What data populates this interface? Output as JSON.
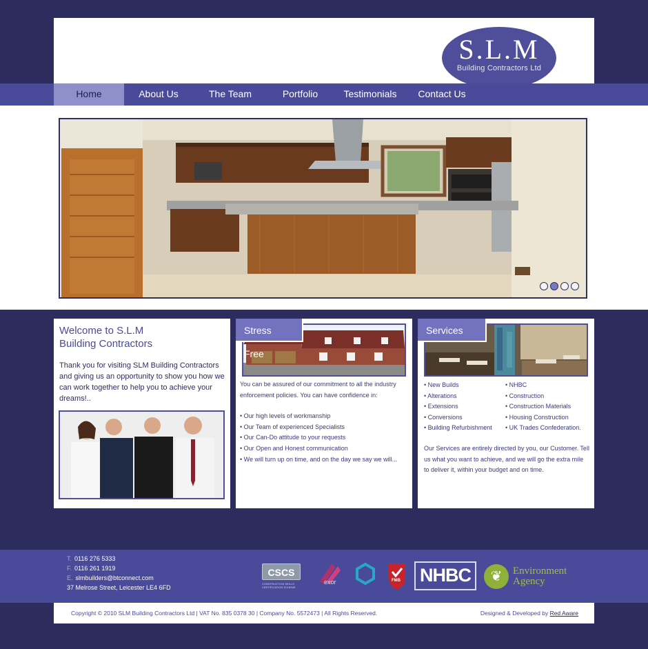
{
  "logo": {
    "title": "S.L.M",
    "subtitle": "Building Contractors Ltd"
  },
  "nav": [
    "Home",
    "About Us",
    "The Team",
    "Portfolio",
    "Testimonials",
    "Contact Us"
  ],
  "nav_active": "Home",
  "slider": {
    "slide_count": 4,
    "active_slide": 2
  },
  "welcome": {
    "title_line1": "Welcome to S.L.M",
    "title_line2": "Building Contractors",
    "text": "Thank you for visiting SLM Building Contractors and giving us an opportunity to show you how we can work together to help you to achieve your dreams!.."
  },
  "stress": {
    "label": "Stress Free",
    "intro": "You can be assured of our commitment to all the industry enforcement policies. You can have confidence in:",
    "items": [
      "• Our high levels of workmanship",
      "• Our Team of experienced Specialists",
      "• Our Can-Do attitude to your requests",
      "• Our Open and Honest communication",
      "• We will turn up on time, and on the day we say we will..."
    ]
  },
  "services": {
    "label": "Services",
    "col1": [
      "• New Builds",
      "• Alterations",
      "• Extensions",
      "• Conversions",
      "• Building Refurbishment"
    ],
    "col2": [
      "• NHBC",
      "• Construction",
      "• Construction Materials",
      "• Housing Construction",
      "• UK Trades Confederation."
    ],
    "text": "Our Services are entirely directed by you, our Customer. Tell us what you want to achieve, and we will go the extra mile to deliver it, within your budget and on time."
  },
  "contact": {
    "t_label": "T.",
    "t": "0116 276 5333",
    "f_label": "F.",
    "f": "0116 261 1919",
    "e_label": "E.",
    "e": "slmbuilders@btconnect.com",
    "address": "37 Melrose Street, Leicester LE4 6FD"
  },
  "logos": {
    "cscs": "CSCS",
    "cscs_sub": "CONSTRUCTION SKILLS CERTIFICATION SCHEME",
    "exor": "exor",
    "fmb": "FMB",
    "nhbc": "NHBC",
    "ea_line1": "Environment",
    "ea_line2": "Agency"
  },
  "footer": {
    "copyright": "Copyright © 2010 SLM Building Contractors Ltd | VAT No. 835 0378 30 | Company No. 5572473 | All Rights Reserved.",
    "designed": "Designed & Developed by ",
    "designer": "Red Aware"
  },
  "colors": {
    "bg": "#2c2c5e",
    "nav": "#4a4a9a",
    "nav_active": "#8f8fcc",
    "tab": "#7272be",
    "text": "#3a3a78"
  }
}
